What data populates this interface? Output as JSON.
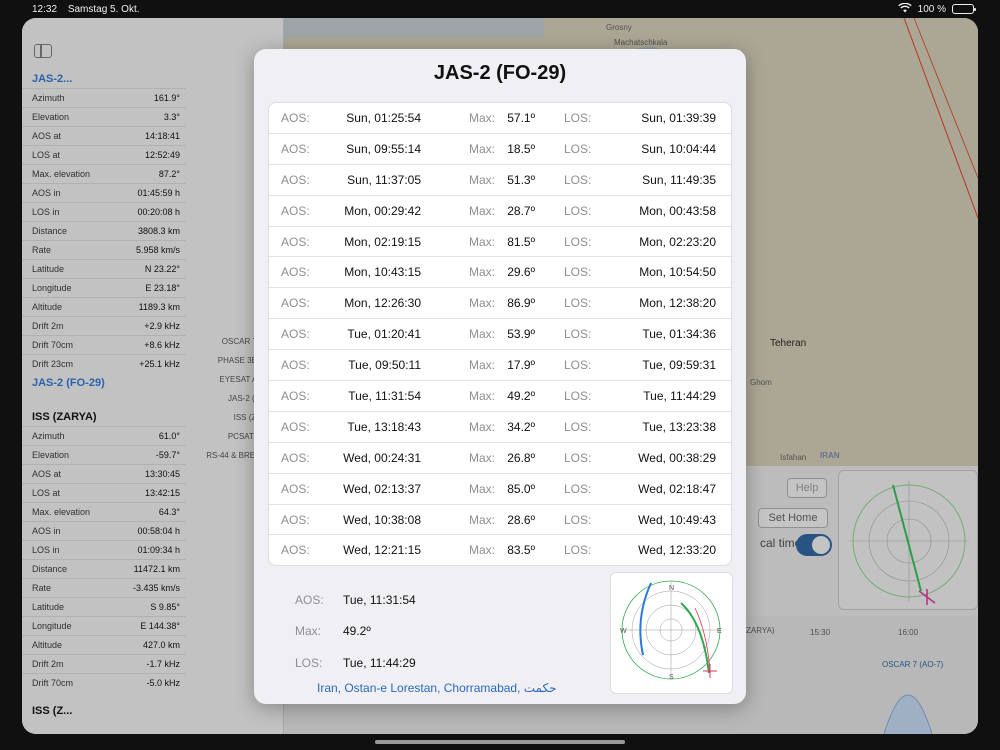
{
  "status_bar": {
    "time": "12:32",
    "date": "Samstag 5. Okt.",
    "battery": "100 %"
  },
  "sidebar": {
    "sat1": {
      "title": "JAS-2...",
      "rows": [
        {
          "label": "Azimuth",
          "value": "161.9°"
        },
        {
          "label": "Elevation",
          "value": "3.3°"
        },
        {
          "label": "AOS at",
          "value": "14:18:41"
        },
        {
          "label": "LOS at",
          "value": "12:52:49"
        },
        {
          "label": "Max. elevation",
          "value": "87.2°"
        },
        {
          "label": "AOS in",
          "value": "01:45:59 h"
        },
        {
          "label": "LOS in",
          "value": "00:20:08 h"
        },
        {
          "label": "Distance",
          "value": "3808.3 km"
        },
        {
          "label": "Rate",
          "value": "5.958 km/s"
        },
        {
          "label": "Latitude",
          "value": "N 23.22°"
        },
        {
          "label": "Longitude",
          "value": "E 23.18°"
        },
        {
          "label": "Altitude",
          "value": "1189.3 km"
        },
        {
          "label": "Drift 2m",
          "value": "+2.9 kHz"
        },
        {
          "label": "Drift 70cm",
          "value": "+8.6 kHz"
        },
        {
          "label": "Drift 23cm",
          "value": "+25.1 kHz"
        }
      ],
      "footer": "JAS-2 (FO-29)"
    },
    "sat2": {
      "title": "ISS (ZARYA)",
      "rows": [
        {
          "label": "Azimuth",
          "value": "61.0°"
        },
        {
          "label": "Elevation",
          "value": "-59.7°"
        },
        {
          "label": "AOS at",
          "value": "13:30:45"
        },
        {
          "label": "LOS at",
          "value": "13:42:15"
        },
        {
          "label": "Max. elevation",
          "value": "64.3°"
        },
        {
          "label": "AOS in",
          "value": "00:58:04 h"
        },
        {
          "label": "LOS in",
          "value": "01:09:34 h"
        },
        {
          "label": "Distance",
          "value": "11472.1 km"
        },
        {
          "label": "Rate",
          "value": "-3.435 km/s"
        },
        {
          "label": "Latitude",
          "value": "S 9.85°"
        },
        {
          "label": "Longitude",
          "value": "E 144.38°"
        },
        {
          "label": "Altitude",
          "value": "427.0 km"
        },
        {
          "label": "Drift 2m",
          "value": "-1.7 kHz"
        },
        {
          "label": "Drift 70cm",
          "value": "-5.0 kHz"
        }
      ],
      "footer": "ISS (Z..."
    },
    "satlist": [
      "OSCAR 7 (AO...",
      "PHASE 3B (AO...",
      "EYESAT A (AO...",
      "JAS-2 (FO-29)",
      "ISS (ZARYA)",
      "PCSAT (NO-...",
      "RS-44 & BREEZE-..."
    ]
  },
  "map": {
    "labels": [
      "Grosny",
      "Machatschkala",
      "Teheran",
      "Ghom",
      "Isfahan",
      "IRAN"
    ]
  },
  "controls": {
    "help": "Help",
    "set_home": "Set Home",
    "local_time": "cal time:",
    "timeline_times": [
      "15:30",
      "16:00"
    ],
    "timeline_sat": "OSCAR 7 (AO-7)",
    "timeline_left": "ZARYA)"
  },
  "modal": {
    "title": "JAS-2 (FO-29)",
    "col_labels": {
      "aos": "AOS:",
      "max": "Max:",
      "los": "LOS:"
    },
    "passes": [
      {
        "aos": "Sun, 01:25:54",
        "max": "57.1º",
        "los": "Sun, 01:39:39"
      },
      {
        "aos": "Sun, 09:55:14",
        "max": "18.5º",
        "los": "Sun, 10:04:44"
      },
      {
        "aos": "Sun, 11:37:05",
        "max": "51.3º",
        "los": "Sun, 11:49:35"
      },
      {
        "aos": "Mon, 00:29:42",
        "max": "28.7º",
        "los": "Mon, 00:43:58"
      },
      {
        "aos": "Mon, 02:19:15",
        "max": "81.5º",
        "los": "Mon, 02:23:20"
      },
      {
        "aos": "Mon, 10:43:15",
        "max": "29.6º",
        "los": "Mon, 10:54:50"
      },
      {
        "aos": "Mon, 12:26:30",
        "max": "86.9º",
        "los": "Mon, 12:38:20"
      },
      {
        "aos": "Tue, 01:20:41",
        "max": "53.9º",
        "los": "Tue, 01:34:36"
      },
      {
        "aos": "Tue, 09:50:11",
        "max": "17.9º",
        "los": "Tue, 09:59:31"
      },
      {
        "aos": "Tue, 11:31:54",
        "max": "49.2º",
        "los": "Tue, 11:44:29"
      },
      {
        "aos": "Tue, 13:18:43",
        "max": "34.2º",
        "los": "Tue, 13:23:38"
      },
      {
        "aos": "Wed, 00:24:31",
        "max": "26.8º",
        "los": "Wed, 00:38:29"
      },
      {
        "aos": "Wed, 02:13:37",
        "max": "85.0º",
        "los": "Wed, 02:18:47"
      },
      {
        "aos": "Wed, 10:38:08",
        "max": "28.6º",
        "los": "Wed, 10:49:43"
      },
      {
        "aos": "Wed, 12:21:15",
        "max": "83.5º",
        "los": "Wed, 12:33:20"
      }
    ],
    "selected": {
      "aos_label": "AOS:",
      "aos": "Tue, 11:31:54",
      "max_label": "Max:",
      "max": "49.2º",
      "los_label": "LOS:",
      "los": "Tue, 11:44:29"
    },
    "location": "Iran, Ostan-e Lorestan, Chorramabad, حکمت",
    "polar_labels": {
      "n": "N",
      "e": "E",
      "s": "S",
      "w": "W"
    }
  },
  "colors": {
    "accent": "#2b69b8",
    "track_green": "#2fa84f",
    "track_blue": "#2a7ad6",
    "marker": "#e0305a"
  }
}
